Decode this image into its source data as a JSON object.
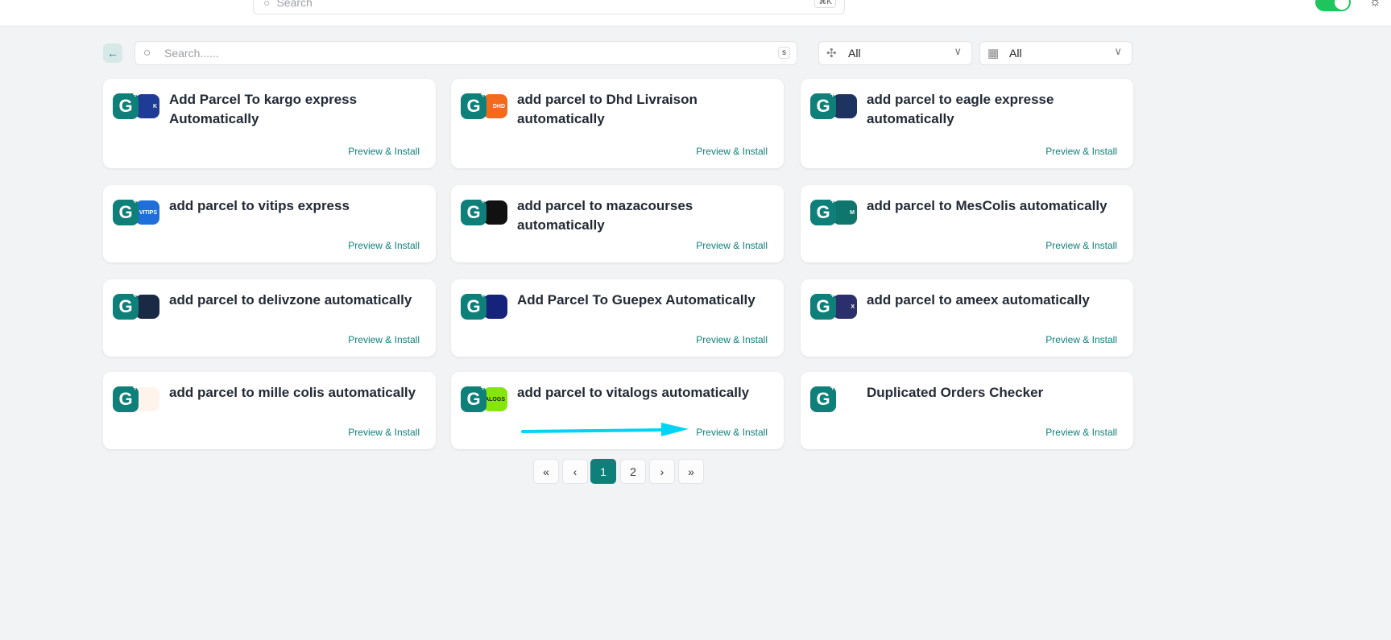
{
  "header": {
    "search_placeholder": "Search",
    "shortcut": "⌘K"
  },
  "filters": {
    "search_placeholder": "Search......",
    "search_shortcut": "s",
    "category": "All",
    "type": "All"
  },
  "cards": [
    {
      "title": "Add Parcel To kargo express Automatically",
      "action": "Preview & Install",
      "brand_color": "#1e3c96",
      "brand_text": "K"
    },
    {
      "title": "add parcel to Dhd Livraison automatically",
      "action": "Preview & Install",
      "brand_color": "#f26b1d",
      "brand_text": "DHD"
    },
    {
      "title": "add parcel to eagle expresse automatically",
      "action": "Preview & Install",
      "brand_color": "#1d3461",
      "brand_text": ""
    },
    {
      "title": "add parcel to vitips express",
      "action": "Preview & Install",
      "brand_color": "#1e6fd9",
      "brand_text": "VITIPS"
    },
    {
      "title": "add parcel to mazacourses automatically",
      "action": "Preview & Install",
      "brand_color": "#111111",
      "brand_text": ""
    },
    {
      "title": "add parcel to MesColis automatically",
      "action": "Preview & Install",
      "brand_color": "#0f766e",
      "brand_text": "M"
    },
    {
      "title": "add parcel to delivzone automatically",
      "action": "Preview & Install",
      "brand_color": "#1b2a44",
      "brand_text": ""
    },
    {
      "title": "Add Parcel To Guepex Automatically",
      "action": "Preview & Install",
      "brand_color": "#16237a",
      "brand_text": ""
    },
    {
      "title": "add parcel to ameex automatically",
      "action": "Preview & Install",
      "brand_color": "#2b2f6b",
      "brand_text": "X"
    },
    {
      "title": "add parcel to mille colis automatically",
      "action": "Preview & Install",
      "brand_color": "#fff4ec",
      "brand_text": ""
    },
    {
      "title": "add parcel to vitalogs automatically",
      "action": "Preview & Install",
      "brand_color": "#84e60d",
      "brand_text": "VITALOGS"
    },
    {
      "title": "Duplicated Orders Checker",
      "action": "Preview & Install",
      "brand_color": "",
      "brand_text": ""
    }
  ],
  "pagination": {
    "first": "«",
    "prev": "‹",
    "pages": [
      "1",
      "2"
    ],
    "current": "1",
    "next": "›",
    "last": "»"
  }
}
